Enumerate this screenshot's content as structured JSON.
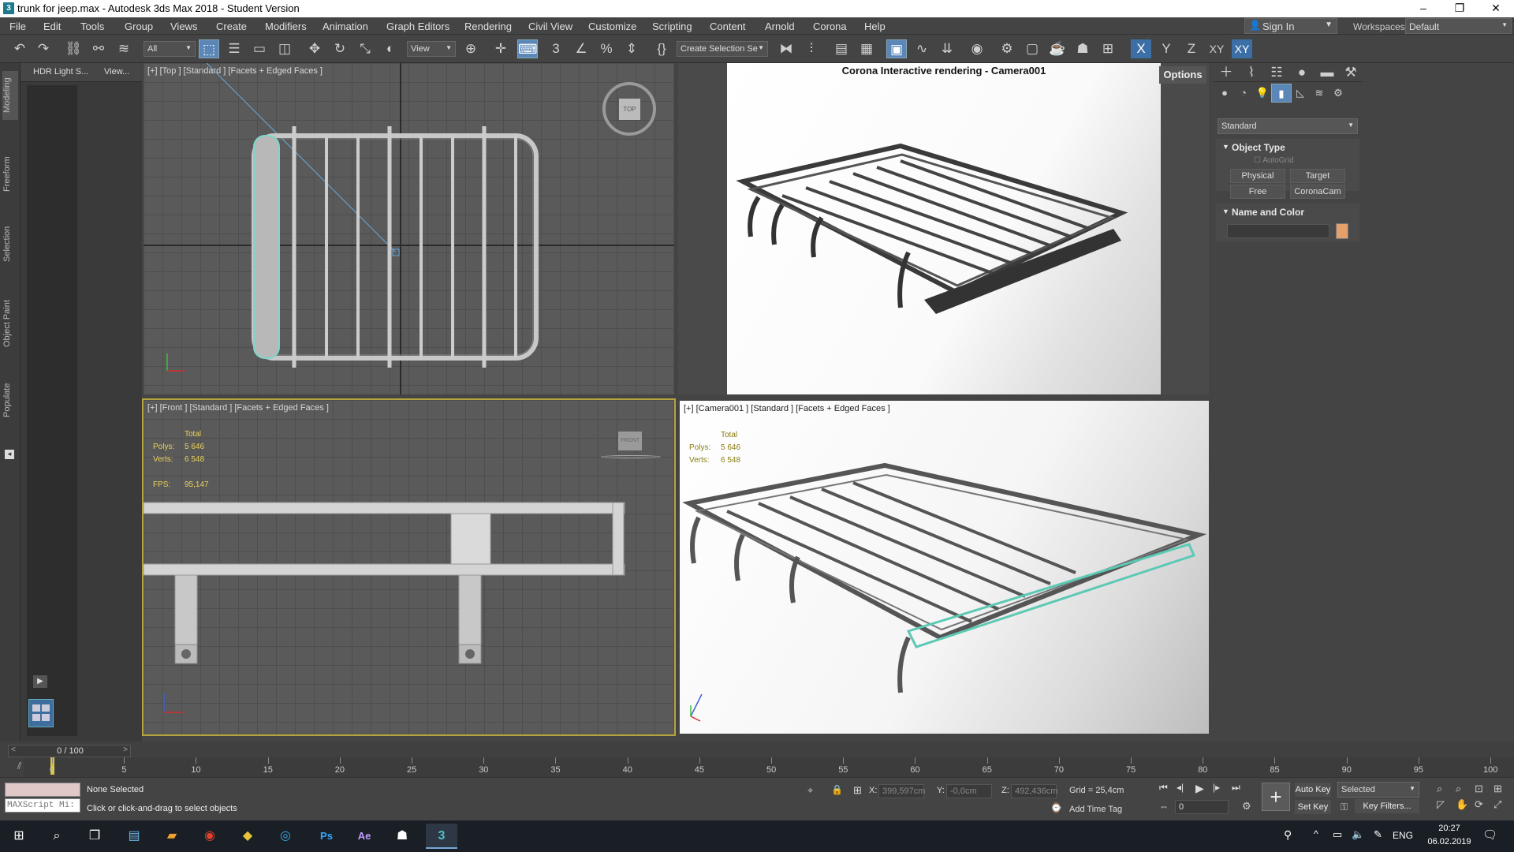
{
  "window": {
    "title": "trunk for jeep.max - Autodesk 3ds Max 2018 - Student Version",
    "app_icon": "3",
    "minimize": "–",
    "maximize": "❐",
    "close": "✕"
  },
  "menu": [
    "File",
    "Edit",
    "Tools",
    "Group",
    "Views",
    "Create",
    "Modifiers",
    "Animation",
    "Graph Editors",
    "Rendering",
    "Civil View",
    "Customize",
    "Scripting",
    "Content",
    "Arnold",
    "Corona",
    "Help"
  ],
  "header_right": {
    "sign_in": "Sign In",
    "workspaces_label": "Workspaces:",
    "workspace": "Default"
  },
  "toolbar": {
    "filter": "All",
    "ref_coord": "View",
    "selection_set": "Create Selection Se",
    "axis_x": "X",
    "axis_y": "Y",
    "axis_z": "Z",
    "axis_xy": "XY",
    "axis_xy2": "XY"
  },
  "left_tabs": [
    "Modeling",
    "Freeform",
    "Selection",
    "Object Paint",
    "Populate"
  ],
  "left_panel": {
    "tab1": "HDR Light S...",
    "tab2": "View..."
  },
  "viewports": {
    "top": {
      "label": "[+] [Top ] [Standard ] [Facets + Edged Faces ]",
      "cube": "TOP"
    },
    "front": {
      "label": "[+] [Front ] [Standard ] [Facets + Edged Faces ]",
      "cube": "FRONT"
    },
    "camera": {
      "label": "[+] [Camera001 ] [Standard ] [Facets + Edged Faces ]"
    },
    "render": {
      "title": "Corona Interactive rendering - Camera001",
      "options": "Options"
    }
  },
  "stats": {
    "total": "Total",
    "polys_label": "Polys:",
    "polys": "5 646",
    "verts_label": "Verts:",
    "verts": "6 548",
    "fps_label": "FPS:",
    "fps": "95,147"
  },
  "command_panel": {
    "category": "Standard",
    "object_type": "Object Type",
    "autogrid": "AutoGrid",
    "buttons": [
      "Physical",
      "Target",
      "Free",
      "CoronaCam"
    ],
    "name_and_color": "Name and Color",
    "color": "#e4a06a"
  },
  "timeline": {
    "frame": "0 / 100",
    "ticks": [
      "0",
      "5",
      "10",
      "15",
      "20",
      "25",
      "30",
      "35",
      "40",
      "45",
      "50",
      "55",
      "60",
      "65",
      "70",
      "75",
      "80",
      "85",
      "90",
      "95",
      "100"
    ]
  },
  "status": {
    "selection": "None Selected",
    "prompt": "Click or click-and-drag to select objects",
    "maxscript": "MAXScript Mi:",
    "x_label": "X:",
    "x": "399,597cm",
    "y_label": "Y:",
    "y": "-0,0cm",
    "z_label": "Z:",
    "z": "492,436cm",
    "grid": "Grid = 25,4cm",
    "add_time_tag": "Add Time Tag",
    "auto_key": "Auto Key",
    "set_key": "Set Key",
    "key_mode": "Selected",
    "key_filters": "Key Filters...",
    "frame_value": "0"
  },
  "taskbar": {
    "lang": "ENG",
    "time": "20:27",
    "date": "06.02.2019"
  }
}
